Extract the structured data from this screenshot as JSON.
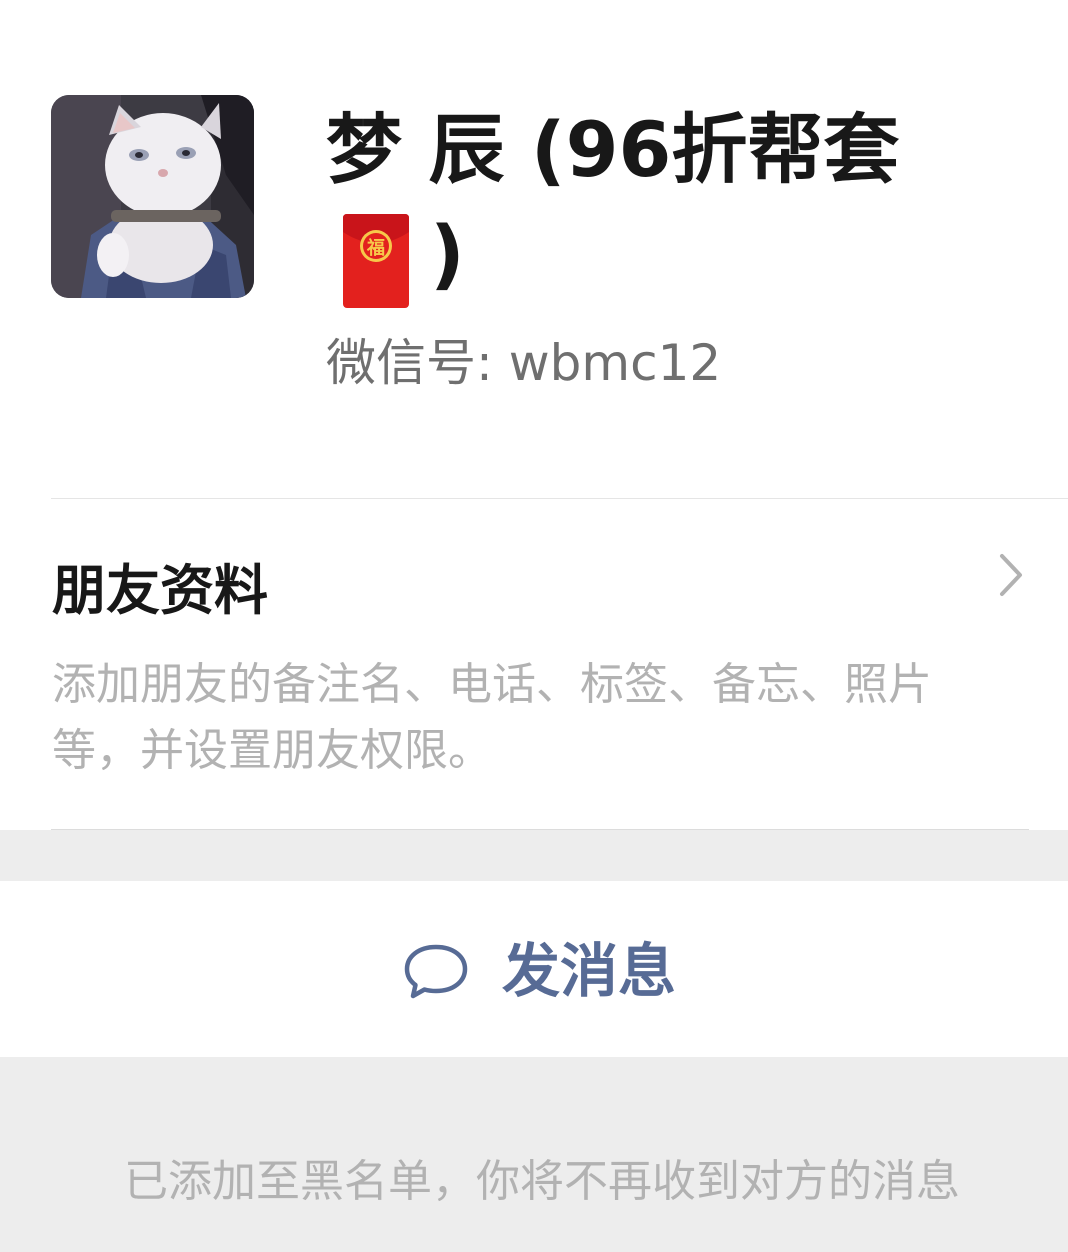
{
  "profile": {
    "name_line1": "梦 辰 (96折帮套",
    "name_emoji": "red-envelope-fu",
    "name_line2": ")",
    "wechat_id": "微信号:  wbmc12"
  },
  "friend_info": {
    "title": "朋友资料",
    "description": "添加朋友的备注名、电话、标签、备忘、照片等，并设置朋友权限。"
  },
  "actions": {
    "send_message_label": "发消息",
    "send_message_icon": "chat-bubble-icon"
  },
  "footer": {
    "blacklist_note": "已添加至黑名单，你将不再收到对方的消息"
  },
  "colors": {
    "page_background": "#ededed",
    "card_background": "#ffffff",
    "link_blue": "#576b95",
    "secondary_text": "#6f6f6f",
    "hint_text": "#b2b2b2",
    "envelope_red": "#e3211e",
    "envelope_gold": "#f7c84a"
  }
}
